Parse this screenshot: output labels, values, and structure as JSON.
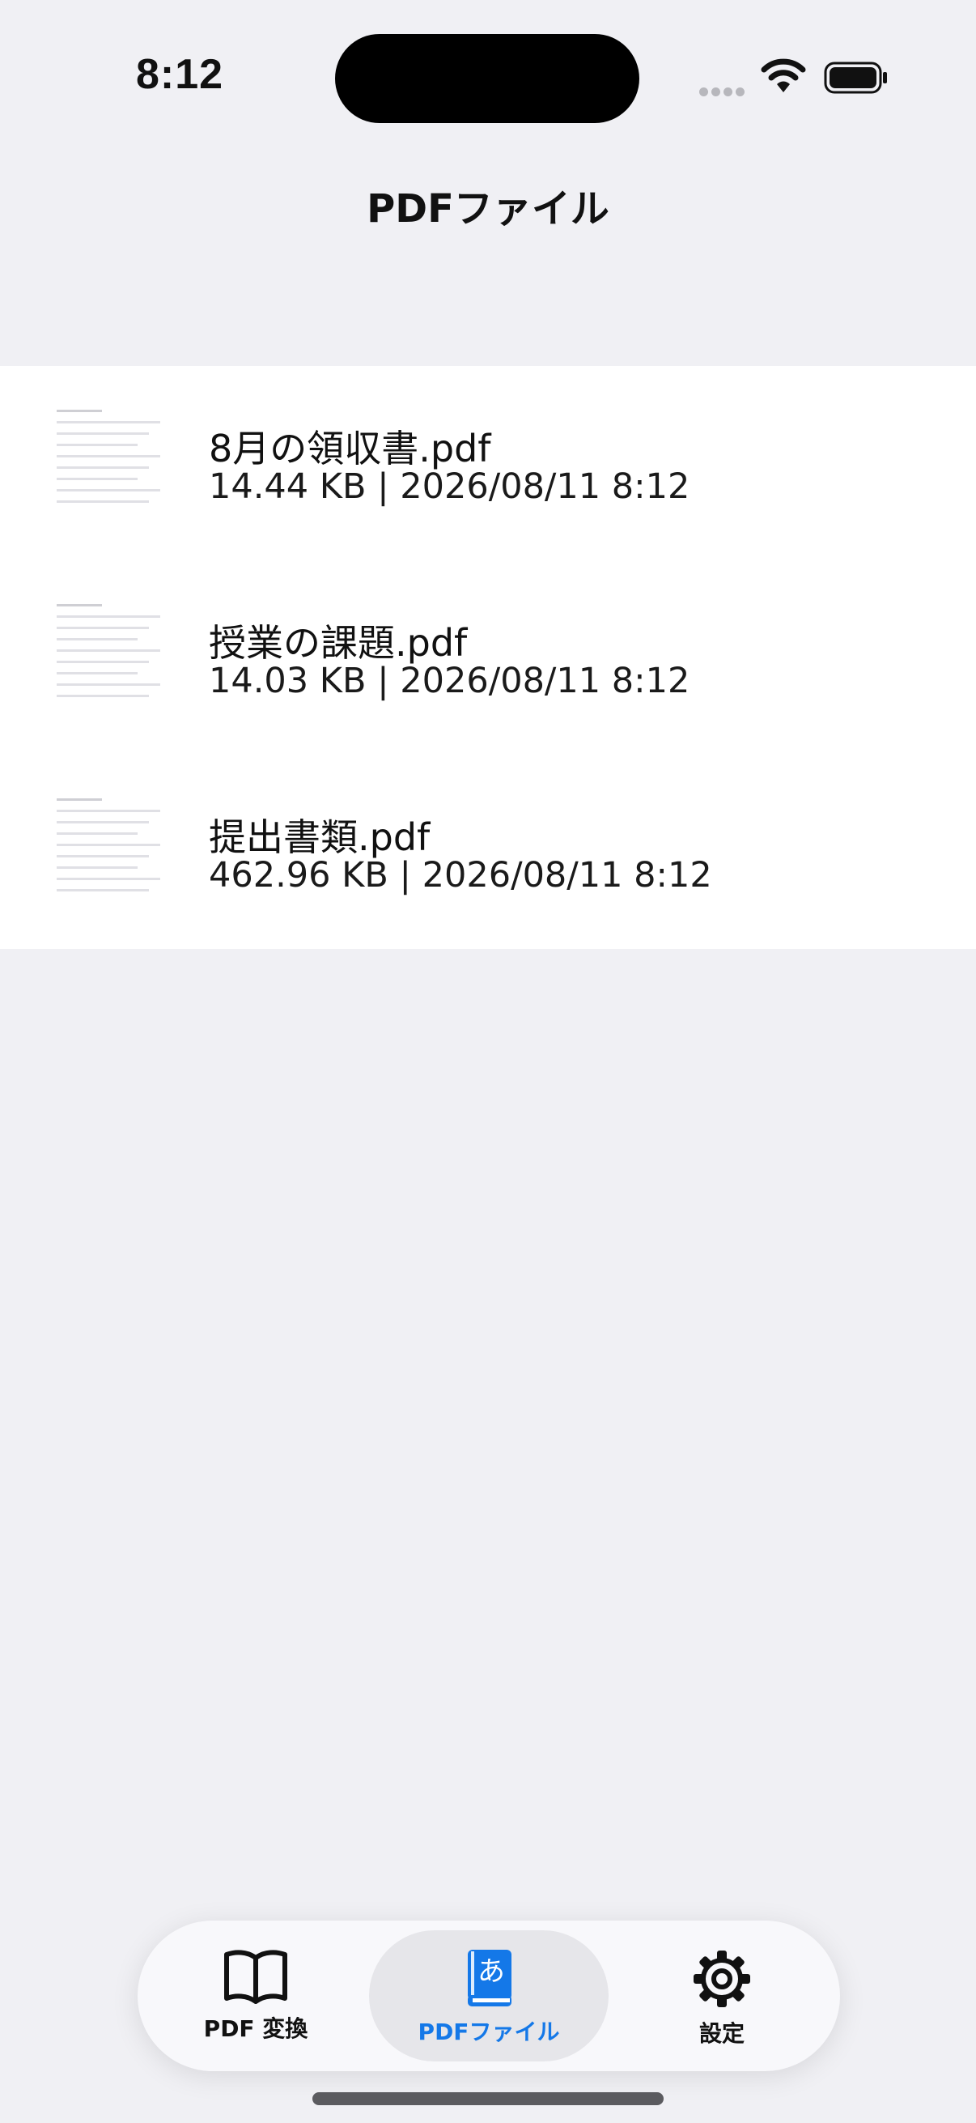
{
  "status_bar": {
    "time": "8:12"
  },
  "nav": {
    "title": "PDFファイル"
  },
  "files": [
    {
      "name": "8月の領収書.pdf",
      "meta": "14.44 KB | 2026/08/11 8:12"
    },
    {
      "name": "授業の課題.pdf",
      "meta": "14.03 KB | 2026/08/11 8:12"
    },
    {
      "name": "提出書類.pdf",
      "meta": "462.96 KB | 2026/08/11 8:12"
    }
  ],
  "tabs": [
    {
      "label": "PDF 変換",
      "icon": "book-open-icon",
      "active": false
    },
    {
      "label": "PDFファイル",
      "icon": "dictionary-book-icon",
      "active": true
    },
    {
      "label": "設定",
      "icon": "gear-icon",
      "active": false
    }
  ],
  "colors": {
    "accent": "#1478e8",
    "background": "#f0f0f4",
    "list_background": "#ffffff"
  }
}
